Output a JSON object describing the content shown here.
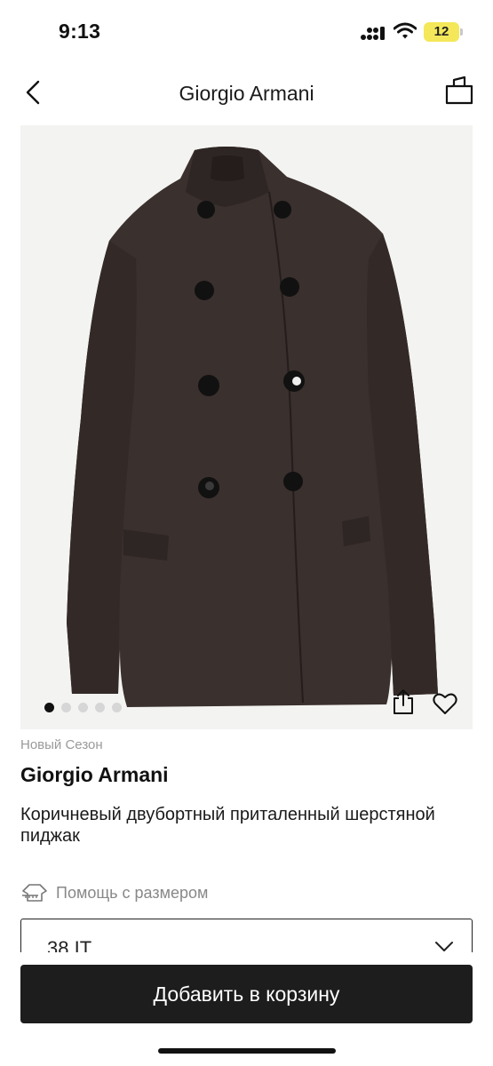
{
  "status_bar": {
    "time": "9:13",
    "battery_level": "12",
    "icons": [
      "cellular-signal-icon",
      "wifi-icon",
      "battery-icon"
    ],
    "battery_color": "#f4e85a"
  },
  "nav": {
    "title": "Giorgio Armani",
    "back_icon": "chevron-left-icon",
    "bag_icon": "shopping-bag-icon"
  },
  "gallery": {
    "image_alt": "brown-double-breasted-jacket",
    "page_count": 5,
    "active_page": 1,
    "share_icon": "share-icon",
    "favorite_icon": "heart-icon",
    "background": "#f3f3f1",
    "product_color": "#3a302e"
  },
  "product": {
    "season": "Новый Сезон",
    "brand": "Giorgio Armani",
    "title": "Коричневый двубортный приталенный шерстяной пиджак"
  },
  "size": {
    "help_label": "Помощь с размером",
    "help_icon": "size-chart-icon",
    "selected": "38 IT",
    "dropdown_icon": "chevron-down-icon"
  },
  "cart": {
    "button_label": "Добавить в корзину",
    "button_color": "#1d1d1d"
  }
}
